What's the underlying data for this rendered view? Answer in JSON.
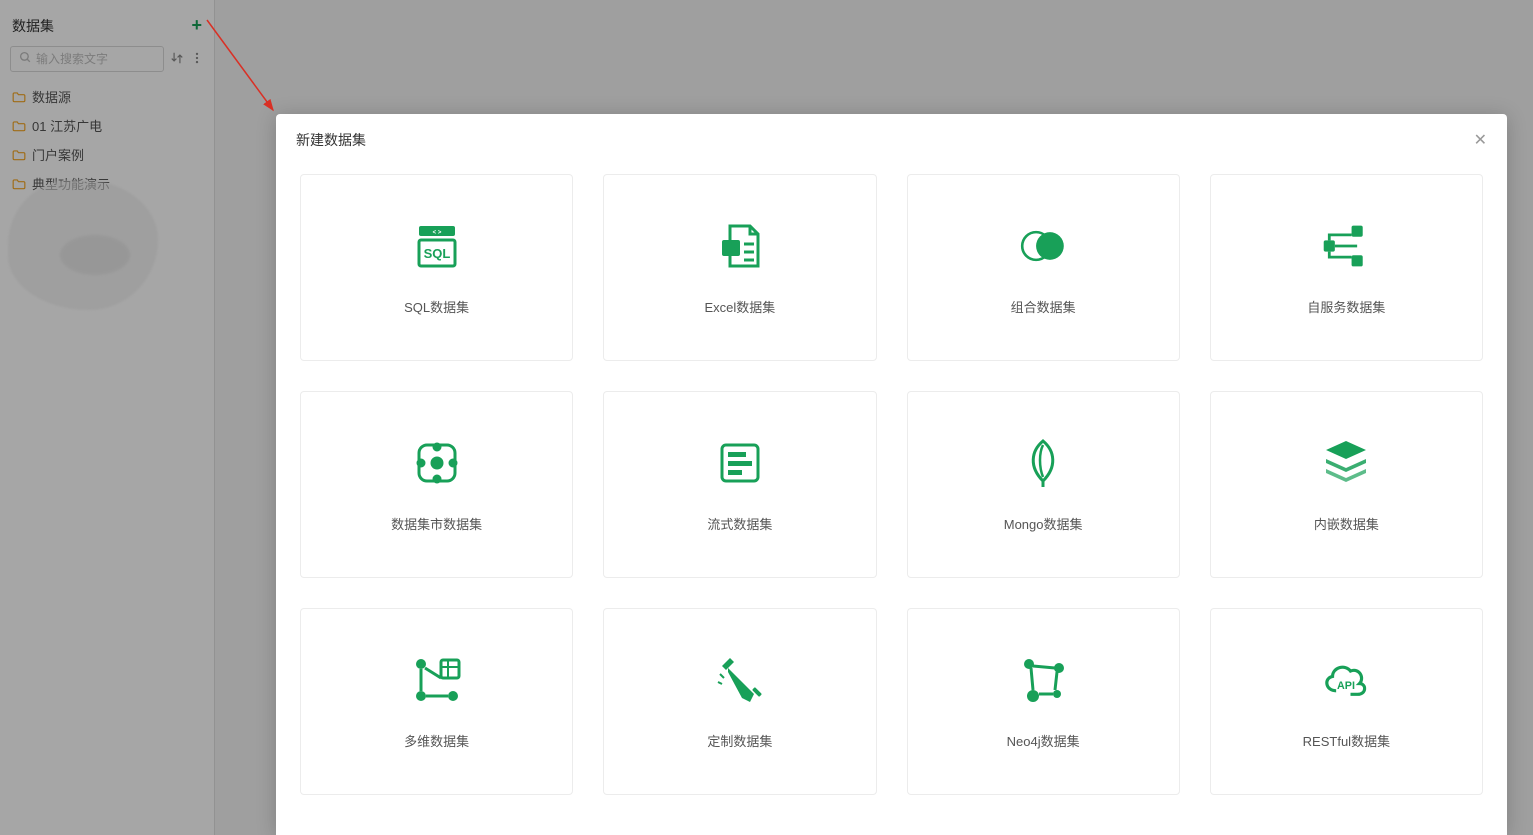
{
  "sidebar": {
    "title": "数据集",
    "search_placeholder": "输入搜索文字",
    "folders": [
      {
        "label": "数据源"
      },
      {
        "label": "01 江苏广电"
      },
      {
        "label": "门户案例"
      },
      {
        "label": "典型功能演示"
      }
    ]
  },
  "dialog": {
    "title": "新建数据集",
    "cards": [
      {
        "label": "SQL数据集",
        "icon": "sql"
      },
      {
        "label": "Excel数据集",
        "icon": "excel"
      },
      {
        "label": "组合数据集",
        "icon": "combine"
      },
      {
        "label": "自服务数据集",
        "icon": "selfservice"
      },
      {
        "label": "数据集市数据集",
        "icon": "market"
      },
      {
        "label": "流式数据集",
        "icon": "stream"
      },
      {
        "label": "Mongo数据集",
        "icon": "mongo"
      },
      {
        "label": "内嵌数据集",
        "icon": "embed"
      },
      {
        "label": "多维数据集",
        "icon": "cube"
      },
      {
        "label": "定制数据集",
        "icon": "custom"
      },
      {
        "label": "Neo4j数据集",
        "icon": "neo4j"
      },
      {
        "label": "RESTful数据集",
        "icon": "restful"
      }
    ]
  },
  "colors": {
    "accent": "#18a058",
    "folder": "#f5a623"
  }
}
